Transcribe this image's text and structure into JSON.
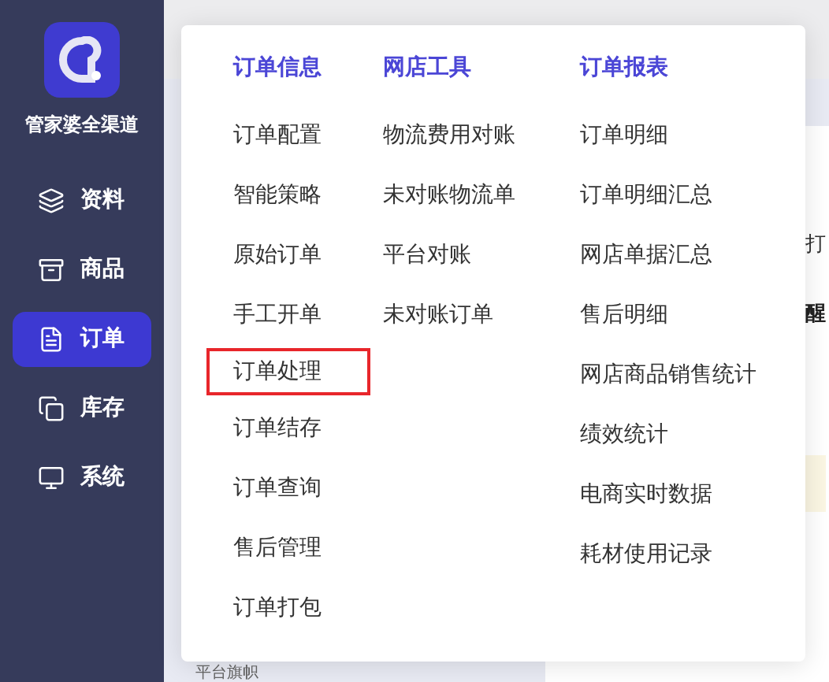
{
  "brand": {
    "name": "管家婆全渠道"
  },
  "nav": [
    {
      "label": "资料",
      "selected": false
    },
    {
      "label": "商品",
      "selected": false
    },
    {
      "label": "订单",
      "selected": true
    },
    {
      "label": "库存",
      "selected": false
    },
    {
      "label": "系统",
      "selected": false
    }
  ],
  "background": {
    "texts": [
      "打",
      "醒"
    ],
    "field_label": "平台旗帜"
  },
  "menu": {
    "columns": [
      {
        "title": "订单信息",
        "items": [
          {
            "label": "订单配置",
            "highlighted": false
          },
          {
            "label": "智能策略",
            "highlighted": false
          },
          {
            "label": "原始订单",
            "highlighted": false
          },
          {
            "label": "手工开单",
            "highlighted": false
          },
          {
            "label": "订单处理",
            "highlighted": true
          },
          {
            "label": "订单结存",
            "highlighted": false
          },
          {
            "label": "订单查询",
            "highlighted": false
          },
          {
            "label": "售后管理",
            "highlighted": false
          },
          {
            "label": "订单打包",
            "highlighted": false
          }
        ]
      },
      {
        "title": "网店工具",
        "items": [
          {
            "label": "物流费用对账",
            "highlighted": false
          },
          {
            "label": "未对账物流单",
            "highlighted": false
          },
          {
            "label": "平台对账",
            "highlighted": false
          },
          {
            "label": "未对账订单",
            "highlighted": false
          }
        ]
      },
      {
        "title": "订单报表",
        "items": [
          {
            "label": "订单明细",
            "highlighted": false
          },
          {
            "label": "订单明细汇总",
            "highlighted": false
          },
          {
            "label": "网店单据汇总",
            "highlighted": false
          },
          {
            "label": "售后明细",
            "highlighted": false
          },
          {
            "label": "网店商品销售统计",
            "highlighted": false
          },
          {
            "label": "绩效统计",
            "highlighted": false
          },
          {
            "label": "电商实时数据",
            "highlighted": false
          },
          {
            "label": "耗材使用记录",
            "highlighted": false
          }
        ]
      }
    ]
  }
}
